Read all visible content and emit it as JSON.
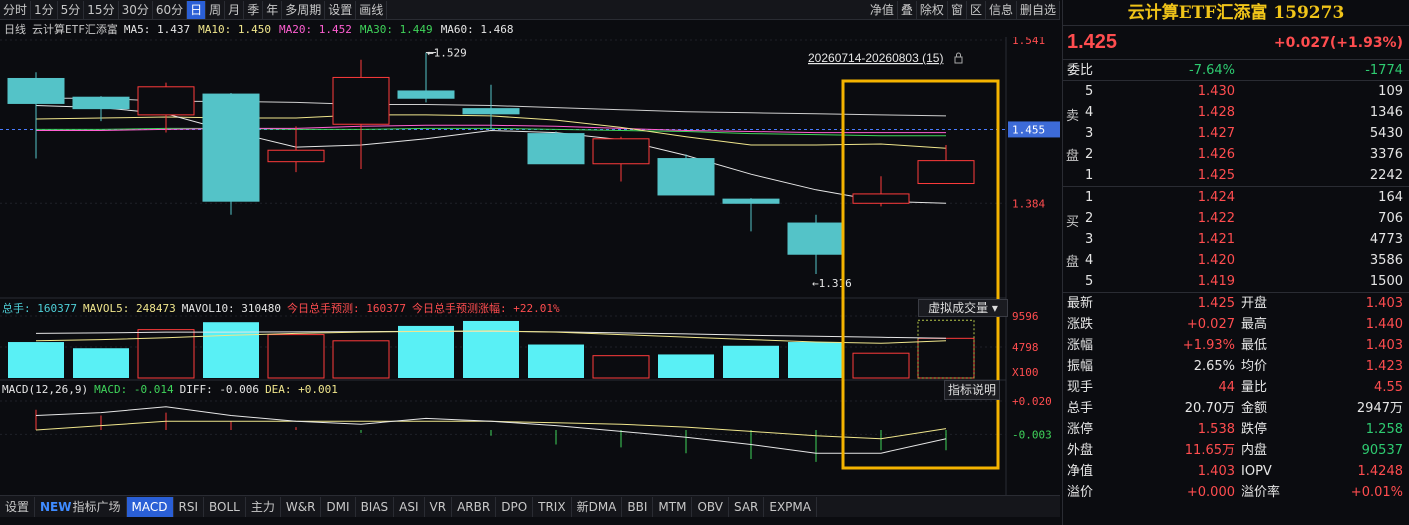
{
  "toolbar": {
    "periods": [
      "分时",
      "1分",
      "5分",
      "15分",
      "30分",
      "60分",
      "日",
      "周",
      "月",
      "季",
      "年",
      "多周期",
      "设置",
      "画线"
    ],
    "active_period": "日",
    "right_buttons": [
      "净值",
      "叠",
      "除权",
      "窗",
      "区",
      "信息",
      "删自选"
    ]
  },
  "ma_line": {
    "period": "日线",
    "name": "云计算ETF汇添富",
    "items": [
      {
        "label": "MA5: 1.437",
        "color": "#e6e6e6"
      },
      {
        "label": "MA10: 1.450",
        "color": "#f0e68c"
      },
      {
        "label": "MA20: 1.452",
        "color": "#ff5fd2"
      },
      {
        "label": "MA30: 1.449",
        "color": "#3fd45a"
      },
      {
        "label": "MA60: 1.468",
        "color": "#e6e6e6"
      }
    ]
  },
  "vol_line": {
    "items": [
      {
        "label": "总手: 160377",
        "color": "#4fd0d8"
      },
      {
        "label": "MAVOL5: 248473",
        "color": "#f0e68c"
      },
      {
        "label": "MAVOL10: 310480",
        "color": "#e6e6e6"
      },
      {
        "label": "今日总手预测: 160377",
        "color": "#ff4d4f"
      },
      {
        "label": "今日总手预测涨幅: +22.01%",
        "color": "#ff4d4f"
      }
    ]
  },
  "macd_line": {
    "items": [
      {
        "label": "MACD(12,26,9)",
        "color": "#e6e6e6"
      },
      {
        "label": "MACD: -0.014",
        "color": "#3fd45a"
      },
      {
        "label": "DIFF: -0.006",
        "color": "#e6e6e6"
      },
      {
        "label": "DEA: +0.001",
        "color": "#f0e68c"
      }
    ]
  },
  "range_label": "20260714-20260803 (15)",
  "virtual_volume_button": "虚拟成交量",
  "indicator_help_button": "指标说明",
  "chart_data": {
    "type": "candlestick",
    "price_axis_labels": [
      "1.541",
      "1.384",
      "1.455"
    ],
    "current_price_tag": "1.455",
    "high_annotation": "1.529",
    "low_annotation": "1.316",
    "candles": [
      {
        "open": 1.504,
        "close": 1.48,
        "high": 1.51,
        "low": 1.427,
        "up": false
      },
      {
        "open": 1.486,
        "close": 1.475,
        "high": 1.487,
        "low": 1.463,
        "up": false
      },
      {
        "open": 1.469,
        "close": 1.496,
        "high": 1.5,
        "low": 1.452,
        "up": true
      },
      {
        "open": 1.489,
        "close": 1.386,
        "high": 1.49,
        "low": 1.373,
        "up": false
      },
      {
        "open": 1.424,
        "close": 1.435,
        "high": 1.458,
        "low": 1.414,
        "up": true
      },
      {
        "open": 1.46,
        "close": 1.505,
        "high": 1.522,
        "low": 1.417,
        "up": true
      },
      {
        "open": 1.492,
        "close": 1.485,
        "high": 1.529,
        "low": 1.481,
        "up": false
      },
      {
        "open": 1.475,
        "close": 1.47,
        "high": 1.498,
        "low": 1.455,
        "up": false
      },
      {
        "open": 1.451,
        "close": 1.422,
        "high": 1.453,
        "low": 1.422,
        "up": false
      },
      {
        "open": 1.446,
        "close": 1.422,
        "high": 1.448,
        "low": 1.405,
        "up": true
      },
      {
        "open": 1.427,
        "close": 1.392,
        "high": 1.431,
        "low": 1.392,
        "up": false
      },
      {
        "open": 1.388,
        "close": 1.384,
        "high": 1.389,
        "low": 1.357,
        "up": false
      },
      {
        "open": 1.365,
        "close": 1.335,
        "high": 1.373,
        "low": 1.316,
        "up": false
      },
      {
        "open": 1.384,
        "close": 1.393,
        "high": 1.41,
        "low": 1.381,
        "up": true
      },
      {
        "open": 1.403,
        "close": 1.425,
        "high": 1.44,
        "low": 1.403,
        "up": true
      }
    ],
    "ma5": [
      1.478,
      1.476,
      1.47,
      1.453,
      1.438,
      1.44,
      1.446,
      1.454,
      1.452,
      1.445,
      1.43,
      1.412,
      1.397,
      1.386,
      1.384
    ],
    "ma10": [
      1.465,
      1.466,
      1.467,
      1.466,
      1.466,
      1.469,
      1.469,
      1.468,
      1.464,
      1.457,
      1.448,
      1.44,
      1.44,
      1.441,
      1.437
    ],
    "ma20": [
      1.454,
      1.454,
      1.455,
      1.456,
      1.456,
      1.458,
      1.459,
      1.459,
      1.458,
      1.456,
      1.454,
      1.453,
      1.452,
      1.452,
      1.452
    ],
    "ma30": [
      1.455,
      1.455,
      1.456,
      1.456,
      1.455,
      1.455,
      1.456,
      1.456,
      1.455,
      1.454,
      1.453,
      1.451,
      1.45,
      1.449,
      1.449
    ],
    "ma60": [
      1.485,
      1.485,
      1.482,
      1.482,
      1.481,
      1.479,
      1.479,
      1.478,
      1.476,
      1.474,
      1.472,
      1.471,
      1.47,
      1.469,
      1.468
    ],
    "volume_axis_labels": [
      "9596",
      "4798",
      "X100"
    ],
    "volumes": [
      1.45,
      1.2,
      1.95,
      2.25,
      1.75,
      1.5,
      2.1,
      2.3,
      1.35,
      0.9,
      0.95,
      1.3,
      1.45,
      1.0,
      1.6
    ],
    "volume_forecast": 2.33,
    "mavol5": [
      1.5,
      1.55,
      1.62,
      1.72,
      1.8,
      1.85,
      1.88,
      1.9,
      1.85,
      1.75,
      1.65,
      1.55,
      1.45,
      1.4,
      1.5
    ],
    "mavol10": [
      1.8,
      1.82,
      1.85,
      1.85,
      1.86,
      1.87,
      1.88,
      1.88,
      1.86,
      1.82,
      1.78,
      1.72,
      1.68,
      1.64,
      1.6
    ],
    "macd_axis_labels": [
      "+0.020",
      "-0.003"
    ],
    "macd_hist": [
      0.014,
      0.01,
      0.012,
      0.006,
      0.002,
      -0.002,
      0.0,
      -0.004,
      -0.01,
      -0.012,
      -0.016,
      -0.02,
      -0.022,
      -0.014,
      -0.014
    ],
    "diff": [
      0.01,
      0.012,
      0.016,
      0.01,
      0.006,
      0.004,
      0.008,
      0.006,
      0.003,
      -0.001,
      -0.005,
      -0.01,
      -0.016,
      -0.016,
      -0.006
    ],
    "dea": [
      0.0,
      0.003,
      0.006,
      0.006,
      0.006,
      0.006,
      0.006,
      0.006,
      0.005,
      0.004,
      0.002,
      -0.001,
      -0.004,
      -0.006,
      0.001
    ]
  },
  "panel": {
    "title": "云计算ETF汇添富 159273",
    "price": "1.425",
    "change": "+0.027(+1.93%)",
    "weibi_label": "委比",
    "weibi_pct": "-7.64%",
    "weibi_val": "-1774",
    "sell_label_1": "卖",
    "sell_label_2": "盘",
    "buy_label_1": "买",
    "buy_label_2": "盘",
    "sells": [
      {
        "level": "5",
        "price": "1.430",
        "vol": "109"
      },
      {
        "level": "4",
        "price": "1.428",
        "vol": "1346"
      },
      {
        "level": "3",
        "price": "1.427",
        "vol": "5430"
      },
      {
        "level": "2",
        "price": "1.426",
        "vol": "3376"
      },
      {
        "level": "1",
        "price": "1.425",
        "vol": "2242"
      }
    ],
    "buys": [
      {
        "level": "1",
        "price": "1.424",
        "vol": "164"
      },
      {
        "level": "2",
        "price": "1.422",
        "vol": "706"
      },
      {
        "level": "3",
        "price": "1.421",
        "vol": "4773"
      },
      {
        "level": "4",
        "price": "1.420",
        "vol": "3586"
      },
      {
        "level": "5",
        "price": "1.419",
        "vol": "1500"
      }
    ],
    "stats": [
      {
        "l1": "最新",
        "v1": "1.425",
        "c1": "red",
        "l2": "开盘",
        "v2": "1.403",
        "c2": "red"
      },
      {
        "l1": "涨跌",
        "v1": "+0.027",
        "c1": "red",
        "l2": "最高",
        "v2": "1.440",
        "c2": "red"
      },
      {
        "l1": "涨幅",
        "v1": "+1.93%",
        "c1": "red",
        "l2": "最低",
        "v2": "1.403",
        "c2": "red"
      },
      {
        "l1": "振幅",
        "v1": "2.65%",
        "c1": "wht",
        "l2": "均价",
        "v2": "1.423",
        "c2": "red"
      },
      {
        "l1": "现手",
        "v1": "44",
        "c1": "red",
        "l2": "量比",
        "v2": "4.55",
        "c2": "red"
      },
      {
        "l1": "总手",
        "v1": "20.70万",
        "c1": "wht",
        "l2": "金额",
        "v2": "2947万",
        "c2": "wht"
      },
      {
        "l1": "涨停",
        "v1": "1.538",
        "c1": "red",
        "l2": "跌停",
        "v2": "1.258",
        "c2": "green"
      },
      {
        "l1": "外盘",
        "v1": "11.65万",
        "c1": "red",
        "l2": "内盘",
        "v2": "90537",
        "c2": "green"
      },
      {
        "l1": "净值",
        "v1": "1.403",
        "c1": "red",
        "l2": "IOPV",
        "v2": "1.4248",
        "c2": "red"
      },
      {
        "l1": "溢价",
        "v1": "+0.000",
        "c1": "red",
        "l2": "溢价率",
        "v2": "+0.01%",
        "c2": "red"
      }
    ]
  },
  "tabs": {
    "settings": "设置",
    "new_badge": "NEW",
    "plaza": "指标广场",
    "items": [
      "MACD",
      "RSI",
      "BOLL",
      "主力",
      "W&R",
      "DMI",
      "BIAS",
      "ASI",
      "VR",
      "ARBR",
      "DPO",
      "TRIX",
      "新DMA",
      "BBI",
      "MTM",
      "OBV",
      "SAR",
      "EXPMA"
    ],
    "active": "MACD"
  },
  "colors": {
    "up": "#ff3b3b",
    "down": "#54c3c8",
    "highlight": "#f5b400",
    "axis_label": "#ff4d4f"
  }
}
